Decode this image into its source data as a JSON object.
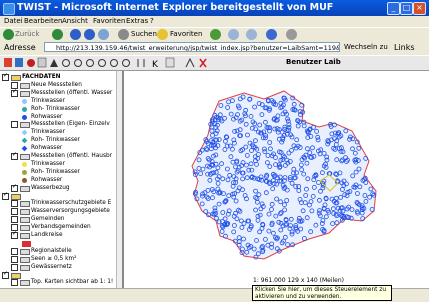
{
  "window": {
    "title": "TWIST - Microsoft Internet Explorer bereitgestellt von MUF"
  },
  "menu": [
    "Datei",
    "Bearbeiten",
    "Ansicht",
    "Favoriten",
    "Extras",
    "?"
  ],
  "toolbar": {
    "back": "Zurück",
    "search": "Suchen",
    "favorites": "Favoriten"
  },
  "address": {
    "label": "Adresse",
    "url": "http://213.139.159.46/twist_erweiterung/jsp/twist_index.jsp?benutzer=LaibSamt=119&typ=",
    "go": "Wechseln zu",
    "links": "Links"
  },
  "app": {
    "user": "Benutzer Laib"
  },
  "layers": [
    {
      "label": "FACHDATEN",
      "checked": true,
      "kind": "folder",
      "level": 0
    },
    {
      "label": "Neue Messstellen",
      "checked": false,
      "kind": "layer",
      "level": 1
    },
    {
      "label": "Messstellen (öffentl. Wasser",
      "checked": true,
      "kind": "layer",
      "level": 1
    },
    {
      "label": "Trinkwasser",
      "kind": "legend",
      "sym": "circle-lblue",
      "level": 2
    },
    {
      "label": "Roh- Trinkwasser",
      "kind": "legend",
      "sym": "circle-teal",
      "level": 2
    },
    {
      "label": "Rohwasser",
      "kind": "legend",
      "sym": "circle-blue",
      "level": 2
    },
    {
      "label": "Messstellen (Eigen- Einzelv",
      "checked": false,
      "kind": "layer",
      "level": 1
    },
    {
      "label": "Trinkwasser",
      "kind": "legend",
      "sym": "diamond-lblue",
      "level": 2
    },
    {
      "label": "Roh- Trinkwasser",
      "kind": "legend",
      "sym": "diamond-teal",
      "level": 2
    },
    {
      "label": "Rohwasser",
      "kind": "legend",
      "sym": "diamond-blue",
      "level": 2
    },
    {
      "label": "Messstellen (öffentl. Hausbr",
      "checked": true,
      "kind": "layer",
      "level": 1
    },
    {
      "label": "Trinkwasser",
      "kind": "legend",
      "sym": "circle-yellow",
      "level": 2
    },
    {
      "label": "Roh- Trinkwasser",
      "kind": "legend",
      "sym": "circle-olive",
      "level": 2
    },
    {
      "label": "Rohwasser",
      "kind": "legend",
      "sym": "circle-brown",
      "level": 2
    },
    {
      "label": "Wasserbezug",
      "checked": true,
      "kind": "layer",
      "level": 1
    },
    {
      "label": "",
      "checked": true,
      "kind": "folder",
      "level": 0
    },
    {
      "label": "Trinkwasserschutzgebiete E",
      "checked": false,
      "kind": "layer",
      "level": 1
    },
    {
      "label": "Wasserversorgungsgebiete",
      "checked": false,
      "kind": "layer",
      "level": 1
    },
    {
      "label": "Gemeinden",
      "checked": false,
      "kind": "layer",
      "level": 1
    },
    {
      "label": "Verbandsgemeinden",
      "checked": false,
      "kind": "layer",
      "level": 1
    },
    {
      "label": "Landkreise",
      "checked": true,
      "kind": "layer",
      "level": 1
    },
    {
      "label": "",
      "kind": "legend",
      "sym": "rect-red",
      "level": 2
    },
    {
      "label": "Regionalstelle",
      "checked": false,
      "kind": "layer",
      "level": 1
    },
    {
      "label": "Seen ≥ 0,5 km²",
      "checked": false,
      "kind": "layer",
      "level": 1
    },
    {
      "label": "Gewässernetz",
      "checked": false,
      "kind": "layer",
      "level": 1
    },
    {
      "label": "",
      "checked": true,
      "kind": "folder",
      "level": 0
    },
    {
      "label": "Top. Karten sichtbar ab 1: 1!",
      "checked": false,
      "kind": "layer",
      "level": 1
    }
  ],
  "map": {
    "scale": "1: 961.000 129 x 140 (Meilen)"
  },
  "tooltip": {
    "line1": "Klicken Sie hier, um dieses Steuerelement zu",
    "line2": "aktivieren und zu verwenden."
  },
  "colors": {
    "title": "#0a5ce0",
    "points": "#1f4fe8",
    "boundary": "#e04040"
  }
}
